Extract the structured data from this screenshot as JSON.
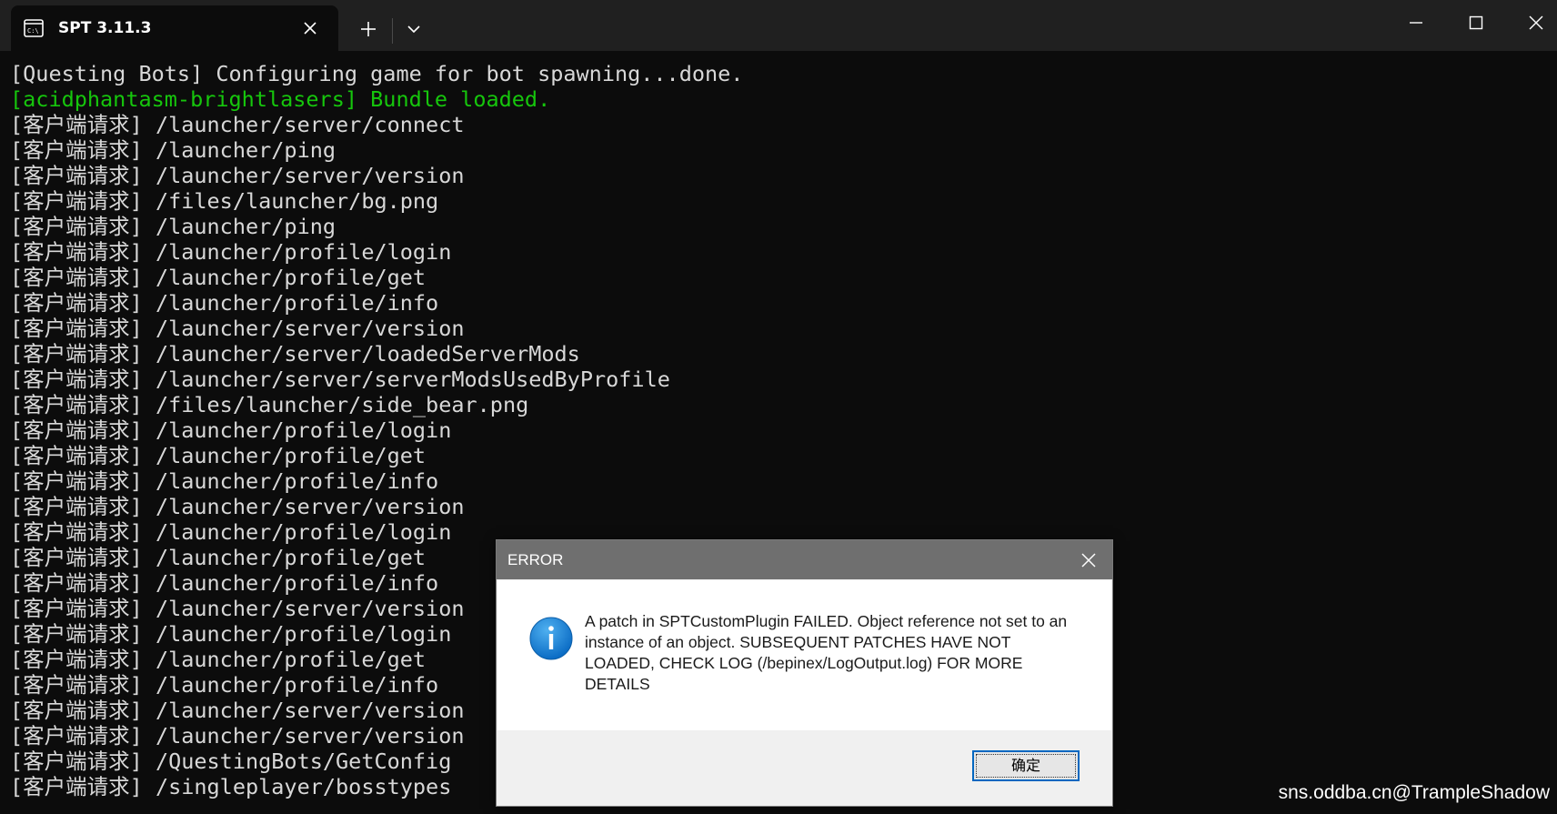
{
  "window": {
    "tab_title": "SPT 3.11.3",
    "tab_icon": "terminal-icon",
    "controls": [
      "minimize-icon",
      "maximize-icon",
      "close-icon"
    ]
  },
  "console": {
    "lines": [
      {
        "text": "[Questing Bots] Configuring game for bot spawning...done.",
        "color": "#d8d8d8"
      },
      {
        "text": "[acidphantasm-brightlasers] Bundle loaded.",
        "color": "#16c60c"
      },
      {
        "text": "[客户端请求] /launcher/server/connect",
        "color": "#d8d8d8"
      },
      {
        "text": "[客户端请求] /launcher/ping",
        "color": "#d8d8d8"
      },
      {
        "text": "[客户端请求] /launcher/server/version",
        "color": "#d8d8d8"
      },
      {
        "text": "[客户端请求] /files/launcher/bg.png",
        "color": "#d8d8d8"
      },
      {
        "text": "[客户端请求] /launcher/ping",
        "color": "#d8d8d8"
      },
      {
        "text": "[客户端请求] /launcher/profile/login",
        "color": "#d8d8d8"
      },
      {
        "text": "[客户端请求] /launcher/profile/get",
        "color": "#d8d8d8"
      },
      {
        "text": "[客户端请求] /launcher/profile/info",
        "color": "#d8d8d8"
      },
      {
        "text": "[客户端请求] /launcher/server/version",
        "color": "#d8d8d8"
      },
      {
        "text": "[客户端请求] /launcher/server/loadedServerMods",
        "color": "#d8d8d8"
      },
      {
        "text": "[客户端请求] /launcher/server/serverModsUsedByProfile",
        "color": "#d8d8d8"
      },
      {
        "text": "[客户端请求] /files/launcher/side_bear.png",
        "color": "#d8d8d8"
      },
      {
        "text": "[客户端请求] /launcher/profile/login",
        "color": "#d8d8d8"
      },
      {
        "text": "[客户端请求] /launcher/profile/get",
        "color": "#d8d8d8"
      },
      {
        "text": "[客户端请求] /launcher/profile/info",
        "color": "#d8d8d8"
      },
      {
        "text": "[客户端请求] /launcher/server/version",
        "color": "#d8d8d8"
      },
      {
        "text": "[客户端请求] /launcher/profile/login",
        "color": "#d8d8d8"
      },
      {
        "text": "[客户端请求] /launcher/profile/get",
        "color": "#d8d8d8"
      },
      {
        "text": "[客户端请求] /launcher/profile/info",
        "color": "#d8d8d8"
      },
      {
        "text": "[客户端请求] /launcher/server/version",
        "color": "#d8d8d8"
      },
      {
        "text": "[客户端请求] /launcher/profile/login",
        "color": "#d8d8d8"
      },
      {
        "text": "[客户端请求] /launcher/profile/get",
        "color": "#d8d8d8"
      },
      {
        "text": "[客户端请求] /launcher/profile/info",
        "color": "#d8d8d8"
      },
      {
        "text": "[客户端请求] /launcher/server/version",
        "color": "#d8d8d8"
      },
      {
        "text": "[客户端请求] /launcher/server/version",
        "color": "#d8d8d8"
      },
      {
        "text": "[客户端请求] /QuestingBots/GetConfig",
        "color": "#d8d8d8"
      },
      {
        "text": "[客户端请求] /singleplayer/bosstypes",
        "color": "#d8d8d8"
      }
    ]
  },
  "dialog": {
    "title": "ERROR",
    "icon": "info-icon",
    "message": "A patch in SPTCustomPlugin FAILED. Object reference not set to an instance of an object. SUBSEQUENT PATCHES HAVE NOT LOADED, CHECK LOG (/bepinex/LogOutput.log) FOR MORE DETAILS",
    "ok_label": "确定"
  },
  "watermark": "sns.oddba.cn@TrampleShadow"
}
